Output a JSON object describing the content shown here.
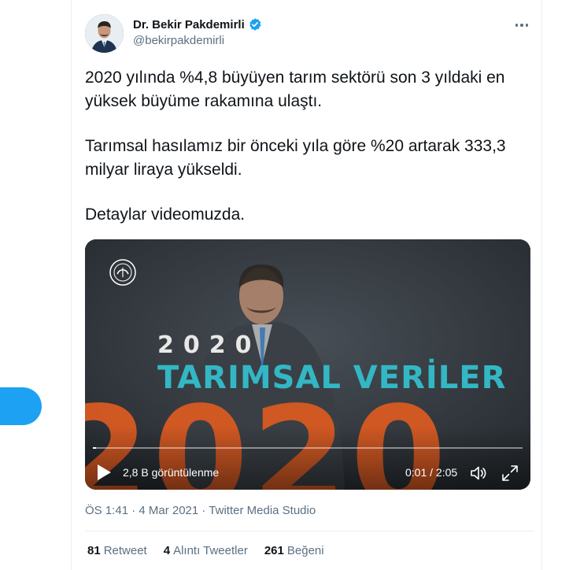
{
  "author": {
    "name": "Dr. Bekir Pakdemirli",
    "handle": "@bekirpakdemirli",
    "verified": true
  },
  "tweet": {
    "paragraphs": [
      "2020 yılında %4,8 büyüyen tarım sektörü son 3 yıldaki en yüksek büyüme rakamına ulaştı.",
      "Tarımsal hasılamız bir önceki yıla göre %20 artarak 333,3 milyar liraya yükseldi.",
      "Detaylar videomuzda."
    ]
  },
  "video": {
    "overlay_year": "2020",
    "overlay_title": "TARIMSAL VERİLER",
    "overlay_big": "2020",
    "views": "2,8 B görüntülenme",
    "time": "0:01 / 2:05",
    "progress": 0.008
  },
  "meta": {
    "timestamp": "ÖS 1:41 · 4 Mar 2021 · Twitter Media Studio"
  },
  "stats": [
    {
      "count": "81",
      "label": "Retweet"
    },
    {
      "count": "4",
      "label": "Alıntı Tweetler"
    },
    {
      "count": "261",
      "label": "Beğeni"
    }
  ],
  "colors": {
    "accent": "#1da1f2",
    "verified": "#1da1f2",
    "secondary_text": "#5b7083",
    "overlay_title": "#33b7c4",
    "overlay_big": "#d85a22"
  },
  "icons": [
    "verified-badge-icon",
    "more-icon",
    "play-icon",
    "volume-icon",
    "fullscreen-icon",
    "ministry-emblem-icon"
  ]
}
